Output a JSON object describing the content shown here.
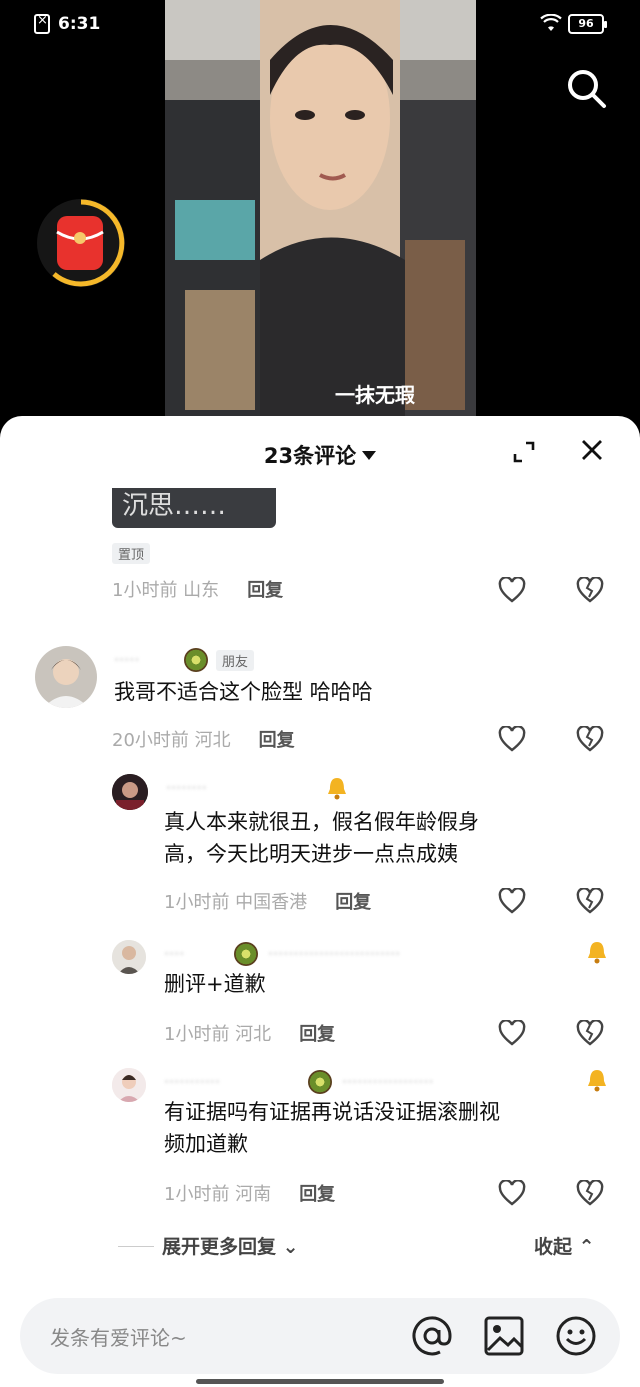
{
  "status": {
    "time": "6:31",
    "battery": "96"
  },
  "sheet": {
    "comment_count": "23条评论",
    "pinned_label": "置顶",
    "thumb_text": "沉思……"
  },
  "comments": [
    {
      "meta_time": "1小时前 山东",
      "reply": "回复"
    },
    {
      "name": "·····",
      "badge": "朋友",
      "text": "我哥不适合这个脸型 哈哈哈",
      "meta_time": "20小时前 河北",
      "reply": "回复"
    },
    {
      "text_line1": "真人本来就很丑，假名假年龄假身",
      "text_line2": "高，今天比明天进步一点点成姨",
      "meta_time": "1小时前 中国香港",
      "reply": "回复"
    },
    {
      "text": "删评+道歉",
      "meta_time": "1小时前 河北",
      "reply": "回复"
    },
    {
      "text_line1": "有证据吗有证据再说话没证据滚删视",
      "text_line2": "频加道歉",
      "meta_time": "1小时前 河南",
      "reply": "回复"
    }
  ],
  "expand_more": "展开更多回复",
  "collapse": "收起",
  "input": {
    "placeholder": "发条有爱评论~"
  },
  "video": {
    "overlay_text": "一抹无瑕"
  },
  "colors": {
    "accent_red": "#e8322d",
    "ring_gold": "#f5b82a"
  },
  "icons": [
    "search-icon",
    "red-packet-icon",
    "expand-icon",
    "close-icon",
    "heart-icon",
    "broken-heart-icon",
    "at-icon",
    "image-icon",
    "emoji-icon"
  ]
}
